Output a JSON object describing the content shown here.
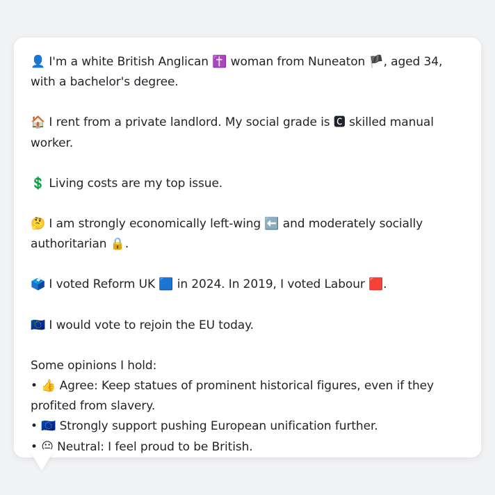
{
  "profile": {
    "identity": {
      "icon": "bust-silhouette-icon",
      "glyph": "👤",
      "text_1": " I'm a white British Anglican ",
      "religion_icon": "latin-cross-icon",
      "religion_glyph": "✝️",
      "text_2": " woman from Nuneaton ",
      "flag_icon": "england-flag-icon",
      "flag_glyph": "🏴",
      "text_3": ", aged 34, with a bachelor's degree."
    },
    "housing": {
      "icon": "house-icon",
      "glyph": "🏠",
      "text_1": " I rent from a private landlord. My social grade is ",
      "grade_icon": "letter-c-icon",
      "grade_glyph": "🅲",
      "text_2": " skilled manual worker."
    },
    "issue": {
      "icon": "dollar-sign-icon",
      "glyph": "💲",
      "text": " Living costs are my top issue."
    },
    "ideology": {
      "icon": "thinking-face-icon",
      "glyph": "🤔",
      "text_1": " I am strongly economically left-wing ",
      "left_icon": "left-arrow-icon",
      "left_glyph": "⬅️",
      "text_2": " and moderately socially authoritarian ",
      "lock_icon": "padlock-icon",
      "lock_glyph": "🔒",
      "text_3": "."
    },
    "vote": {
      "icon": "ballot-box-icon",
      "glyph": "🗳️",
      "text_1": " I voted Reform UK ",
      "reform_icon": "blue-square-icon",
      "reform_glyph": "🟦",
      "text_2": " in 2024. In 2019, I voted Labour ",
      "labour_icon": "red-square-icon",
      "labour_glyph": "🟥",
      "text_3": "."
    },
    "eu": {
      "icon": "eu-flag-icon",
      "glyph": "🇪🇺",
      "text": " I would vote to rejoin the EU today."
    },
    "opinions": {
      "heading": "Some opinions I hold:",
      "items": [
        {
          "bullet": "• ",
          "icon": "thumbs-up-icon",
          "glyph": "👍",
          "text": " Agree: Keep statues of prominent historical figures, even if they profited from slavery."
        },
        {
          "bullet": "• ",
          "icon": "eu-flag-icon",
          "glyph": "🇪🇺",
          "text": " Strongly support pushing European unification further."
        },
        {
          "bullet": "• ",
          "icon": "neutral-face-icon",
          "glyph": "😐",
          "text": " Neutral: I feel proud to be British."
        }
      ]
    }
  },
  "colors": {
    "background": "#f1f2f4",
    "card": "#ffffff",
    "text": "#1f2328"
  }
}
